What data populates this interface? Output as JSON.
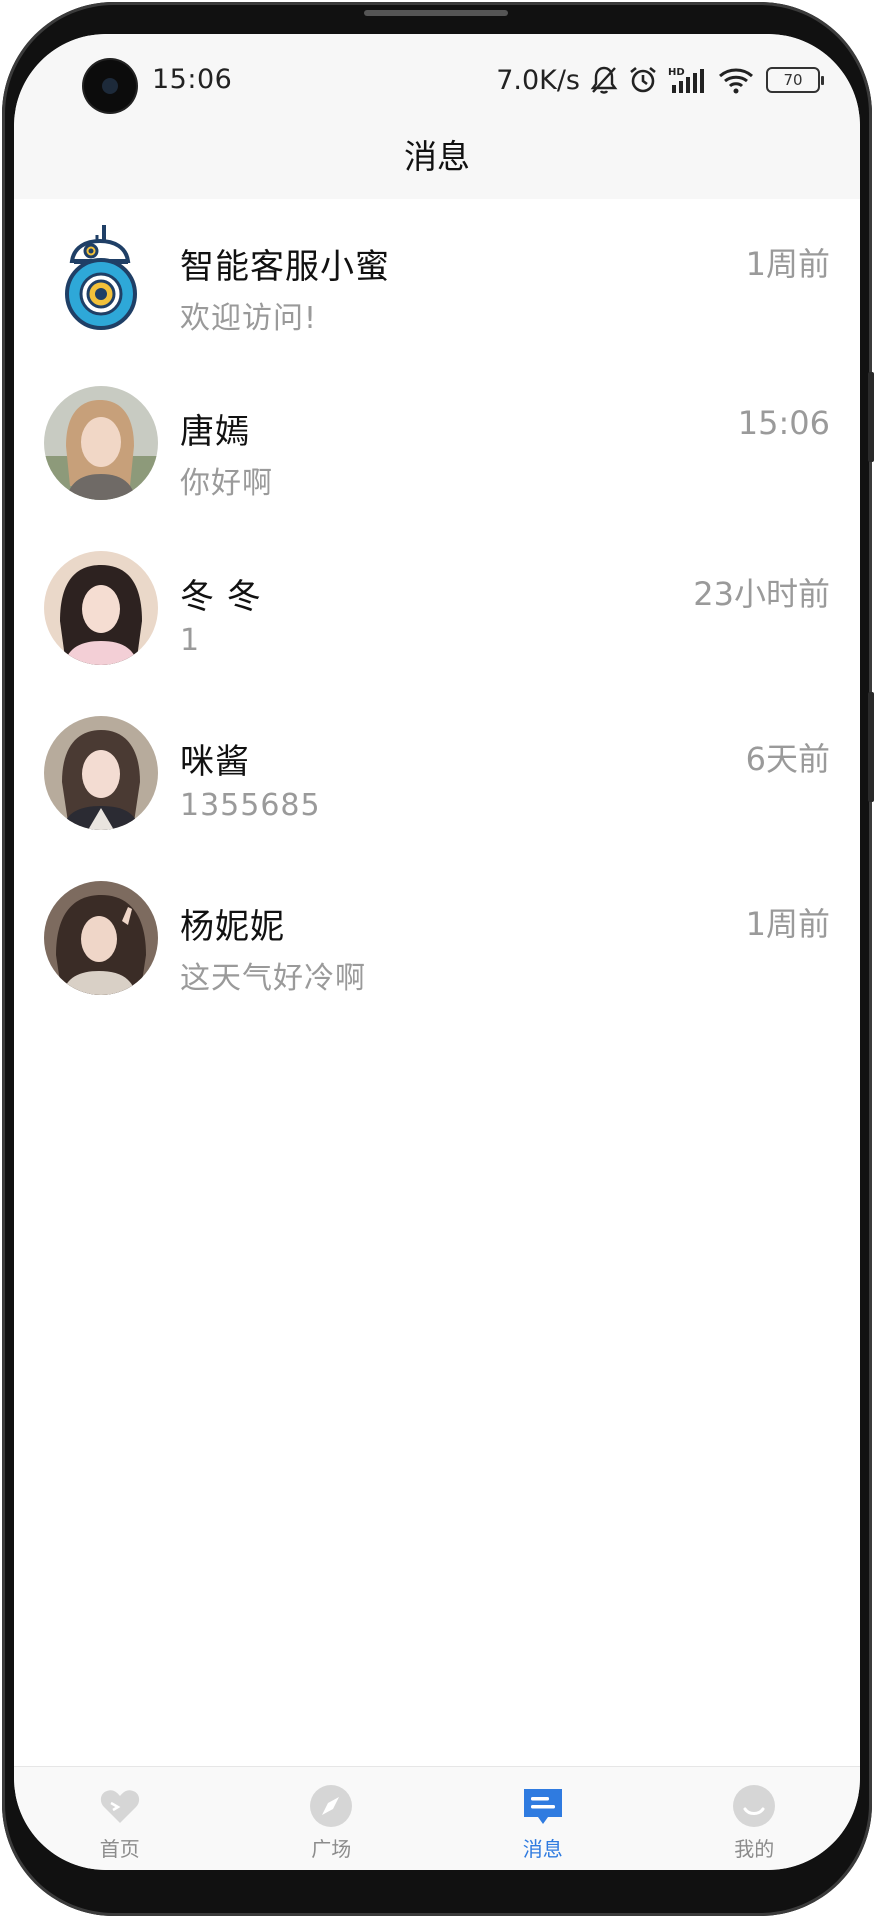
{
  "status_bar": {
    "time": "15:06",
    "network_speed": "7.0K/s",
    "battery": "70"
  },
  "header": {
    "title": "消息"
  },
  "messages": [
    {
      "name": "智能客服小蜜",
      "preview": "欢迎访问!",
      "time": "1周前",
      "avatar": "robot-avatar"
    },
    {
      "name": "唐嫣",
      "preview": "你好啊",
      "time": "15:06",
      "avatar": "photo-avatar"
    },
    {
      "name": "冬 冬",
      "preview": "1",
      "time": "23小时前",
      "avatar": "photo-avatar"
    },
    {
      "name": "咪酱",
      "preview": "1355685",
      "time": "6天前",
      "avatar": "photo-avatar"
    },
    {
      "name": "杨妮妮",
      "preview": "这天气好冷啊",
      "time": "1周前",
      "avatar": "photo-avatar"
    }
  ],
  "tabs": [
    {
      "label": "首页",
      "icon": "heart-icon",
      "active": false
    },
    {
      "label": "广场",
      "icon": "compass-icon",
      "active": false
    },
    {
      "label": "消息",
      "icon": "message-icon",
      "active": true
    },
    {
      "label": "我的",
      "icon": "smile-icon",
      "active": false
    }
  ],
  "colors": {
    "accent": "#2f7be0",
    "inactive_icon": "#d6d6d6",
    "secondary_text": "#9a9a9a"
  }
}
